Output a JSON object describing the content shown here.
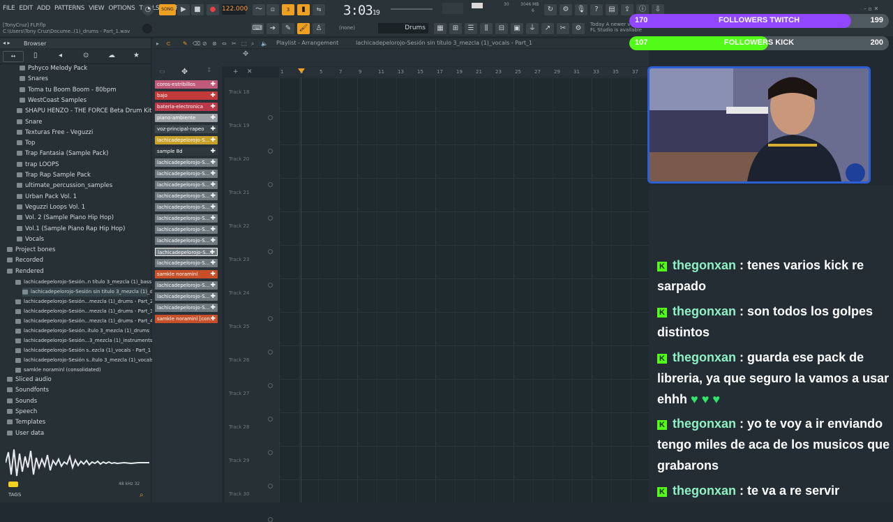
{
  "menu": [
    "FILE",
    "EDIT",
    "ADD",
    "PATTERNS",
    "VIEW",
    "OPTIONS",
    "TOOLS",
    "HELP"
  ],
  "transport": {
    "tempo": "122.000",
    "time": "3:03",
    "time_small": "19",
    "song_label": "SONG"
  },
  "file": {
    "line1": "[TonyCruz] FLP.flp",
    "line2": "C:\\Users\\Tony Cruz\\Docume..(1)_drums - Part_1.wav"
  },
  "cpu": {
    "a": "30",
    "b": "3046 MB",
    "c": "6"
  },
  "toolbar": {
    "snap": "(none)",
    "pattern": "Drums",
    "today_title": "Today",
    "today_line1": "A newer v",
    "today_line2": "FL Studio is available"
  },
  "browser": {
    "title": "Browser",
    "items": [
      {
        "label": "Pshyco Melody Pack",
        "indent": 2
      },
      {
        "label": "Snares",
        "indent": 2
      },
      {
        "label": "Toma tu Boom Boom - 80bpm",
        "indent": 2
      },
      {
        "label": "WestCoast Samples",
        "indent": 2
      },
      {
        "label": "SHAPU HENZO - THE FORCE Beta Drum Kit",
        "indent": 1
      },
      {
        "label": "Snare",
        "indent": 1
      },
      {
        "label": "Texturas Free - Veguzzi",
        "indent": 1
      },
      {
        "label": "Top",
        "indent": 1
      },
      {
        "label": "Trap Fantasia (Sample Pack)",
        "indent": 1
      },
      {
        "label": "trap LOOPS",
        "indent": 1
      },
      {
        "label": "Trap Rap Sample Pack",
        "indent": 1
      },
      {
        "label": "ultimate_percussion_samples",
        "indent": 1
      },
      {
        "label": "Urban Pack Vol. 1",
        "indent": 1
      },
      {
        "label": "Veguzzi Loops Vol. 1",
        "indent": 1
      },
      {
        "label": "Vol. 2 (Sample Piano Hip Hop)",
        "indent": 1
      },
      {
        "label": "Vol.1 (Sample Piano Rap Hip Hop)",
        "indent": 1
      },
      {
        "label": "Vocals",
        "indent": 1
      }
    ],
    "sections": [
      "Project bones",
      "Recorded",
      "Rendered"
    ],
    "rendered": [
      "lachicadepelorojo-Sesión..n título 3_mezcla (1)_bass",
      "lachicadepelorojo-Sesión sin título 3_mezcla (1)_drums - Part_1",
      "lachicadepelorojo-Sesión...mezcla (1)_drums - Part_2",
      "lachicadepelorojo-Sesión...mezcla (1)_drums - Part_3",
      "lachicadepelorojo-Sesión...mezcla (1)_drums - Part_4",
      "lachicadepelorojo-Sesión..ítulo 3_mezcla (1)_drums",
      "lachicadepelorojo-Sesión...3_mezcla (1)_instruments",
      "lachicadepelorojo-Sesión s..ezcla (1)_vocals - Part_1",
      "lachicadepelorojo-Sesión s..ítulo 3_mezcla (1)_vocals",
      "samkle noraminl (consolidated)"
    ],
    "bottom": [
      "Sliced audio",
      "Soundfonts",
      "Sounds",
      "Speech",
      "Templates",
      "User data"
    ],
    "tags": "TAGS",
    "khz": "48 kHz 32"
  },
  "playlist": {
    "title": "Playlist - Arrangement",
    "path": "lachicadepelorojo-Sesión sin título 3_mezcla (1)_vocals - Part_1",
    "ruler": [
      "1",
      "3",
      "5",
      "7",
      "9",
      "11",
      "13",
      "15",
      "17",
      "19",
      "21",
      "23",
      "25",
      "27",
      "29",
      "31",
      "33",
      "35",
      "37"
    ],
    "tracks": [
      "Track 18",
      "Track 19",
      "Track 20",
      "Track 21",
      "Track 22",
      "Track 23",
      "Track 24",
      "Track 25",
      "Track 26",
      "Track 27",
      "Track 28",
      "Track 29",
      "Track 30"
    ]
  },
  "channels": [
    {
      "label": "coros-estribillos",
      "color": "#c05a7a"
    },
    {
      "label": "bajo",
      "color": "#c23a3a"
    },
    {
      "label": "bateria-electronica",
      "color": "#b83a4a"
    },
    {
      "label": "piano-ambiente",
      "color": "#9aa0a3"
    },
    {
      "label": "voz-principal-rapeo",
      "color": "#3b474c"
    },
    {
      "label": "lachicadepelorojo-S...",
      "color": "#c7a12a"
    },
    {
      "label": "sample 8d",
      "color": "#2e383d"
    },
    {
      "label": "lachicadepelorojo-S...",
      "color": "#6f7a80"
    },
    {
      "label": "lachicadepelorojo-S...",
      "color": "#6f7a80"
    },
    {
      "label": "lachicadepelorojo-S...",
      "color": "#6f7a80"
    },
    {
      "label": "lachicadepelorojo-S...",
      "color": "#6f7a80"
    },
    {
      "label": "lachicadepelorojo-S...",
      "color": "#6f7a80"
    },
    {
      "label": "lachicadepelorojo-S...",
      "color": "#6f7a80"
    },
    {
      "label": "lachicadepelorojo-S...",
      "color": "#6f7a80"
    },
    {
      "label": "lachicadepelorojo-S...",
      "color": "#6f7a80"
    },
    {
      "label": "lachicadepelorojo-S...",
      "color": "#6f7a80"
    },
    {
      "label": "lachicadepelorojo-S...",
      "color": "#6f7a80"
    },
    {
      "label": "samkle noraminl",
      "color": "#c7502a"
    },
    {
      "label": "lachicadepelorojo-S...",
      "color": "#6f7a80"
    },
    {
      "label": "lachicadepelorojo-S...",
      "color": "#6f7a80"
    },
    {
      "label": "lachicadepelorojo-S...",
      "color": "#6f7a80"
    },
    {
      "label": "samkle noraminl [con...",
      "color": "#c7502a"
    }
  ],
  "followers": {
    "twitch": {
      "label": "FOLLOWERS TWITCH",
      "current": "170",
      "goal": "199",
      "progress": 0.854,
      "color": "#9146ff"
    },
    "kick": {
      "label": "FOLLOWERS KICK",
      "current": "107",
      "goal": "200",
      "progress": 0.535,
      "color": "#53fc18"
    }
  },
  "chat": [
    {
      "user": "thegonxan",
      "text": "tenes varios kick re sarpado",
      "hearts": ""
    },
    {
      "user": "thegonxan",
      "text": "son todos los golpes distintos",
      "hearts": ""
    },
    {
      "user": "thegonxan",
      "text": "guarda ese pack de libreria, ya que seguro la vamos a usar ehhh",
      "hearts": "♥ ♥ ♥"
    },
    {
      "user": "thegonxan",
      "text": "yo te voy a ir enviando tengo miles de aca de los musicos que grabarons",
      "hearts": ""
    },
    {
      "user": "thegonxan",
      "text": "te va a re servir",
      "hearts": ""
    }
  ],
  "kick_badge": "K"
}
